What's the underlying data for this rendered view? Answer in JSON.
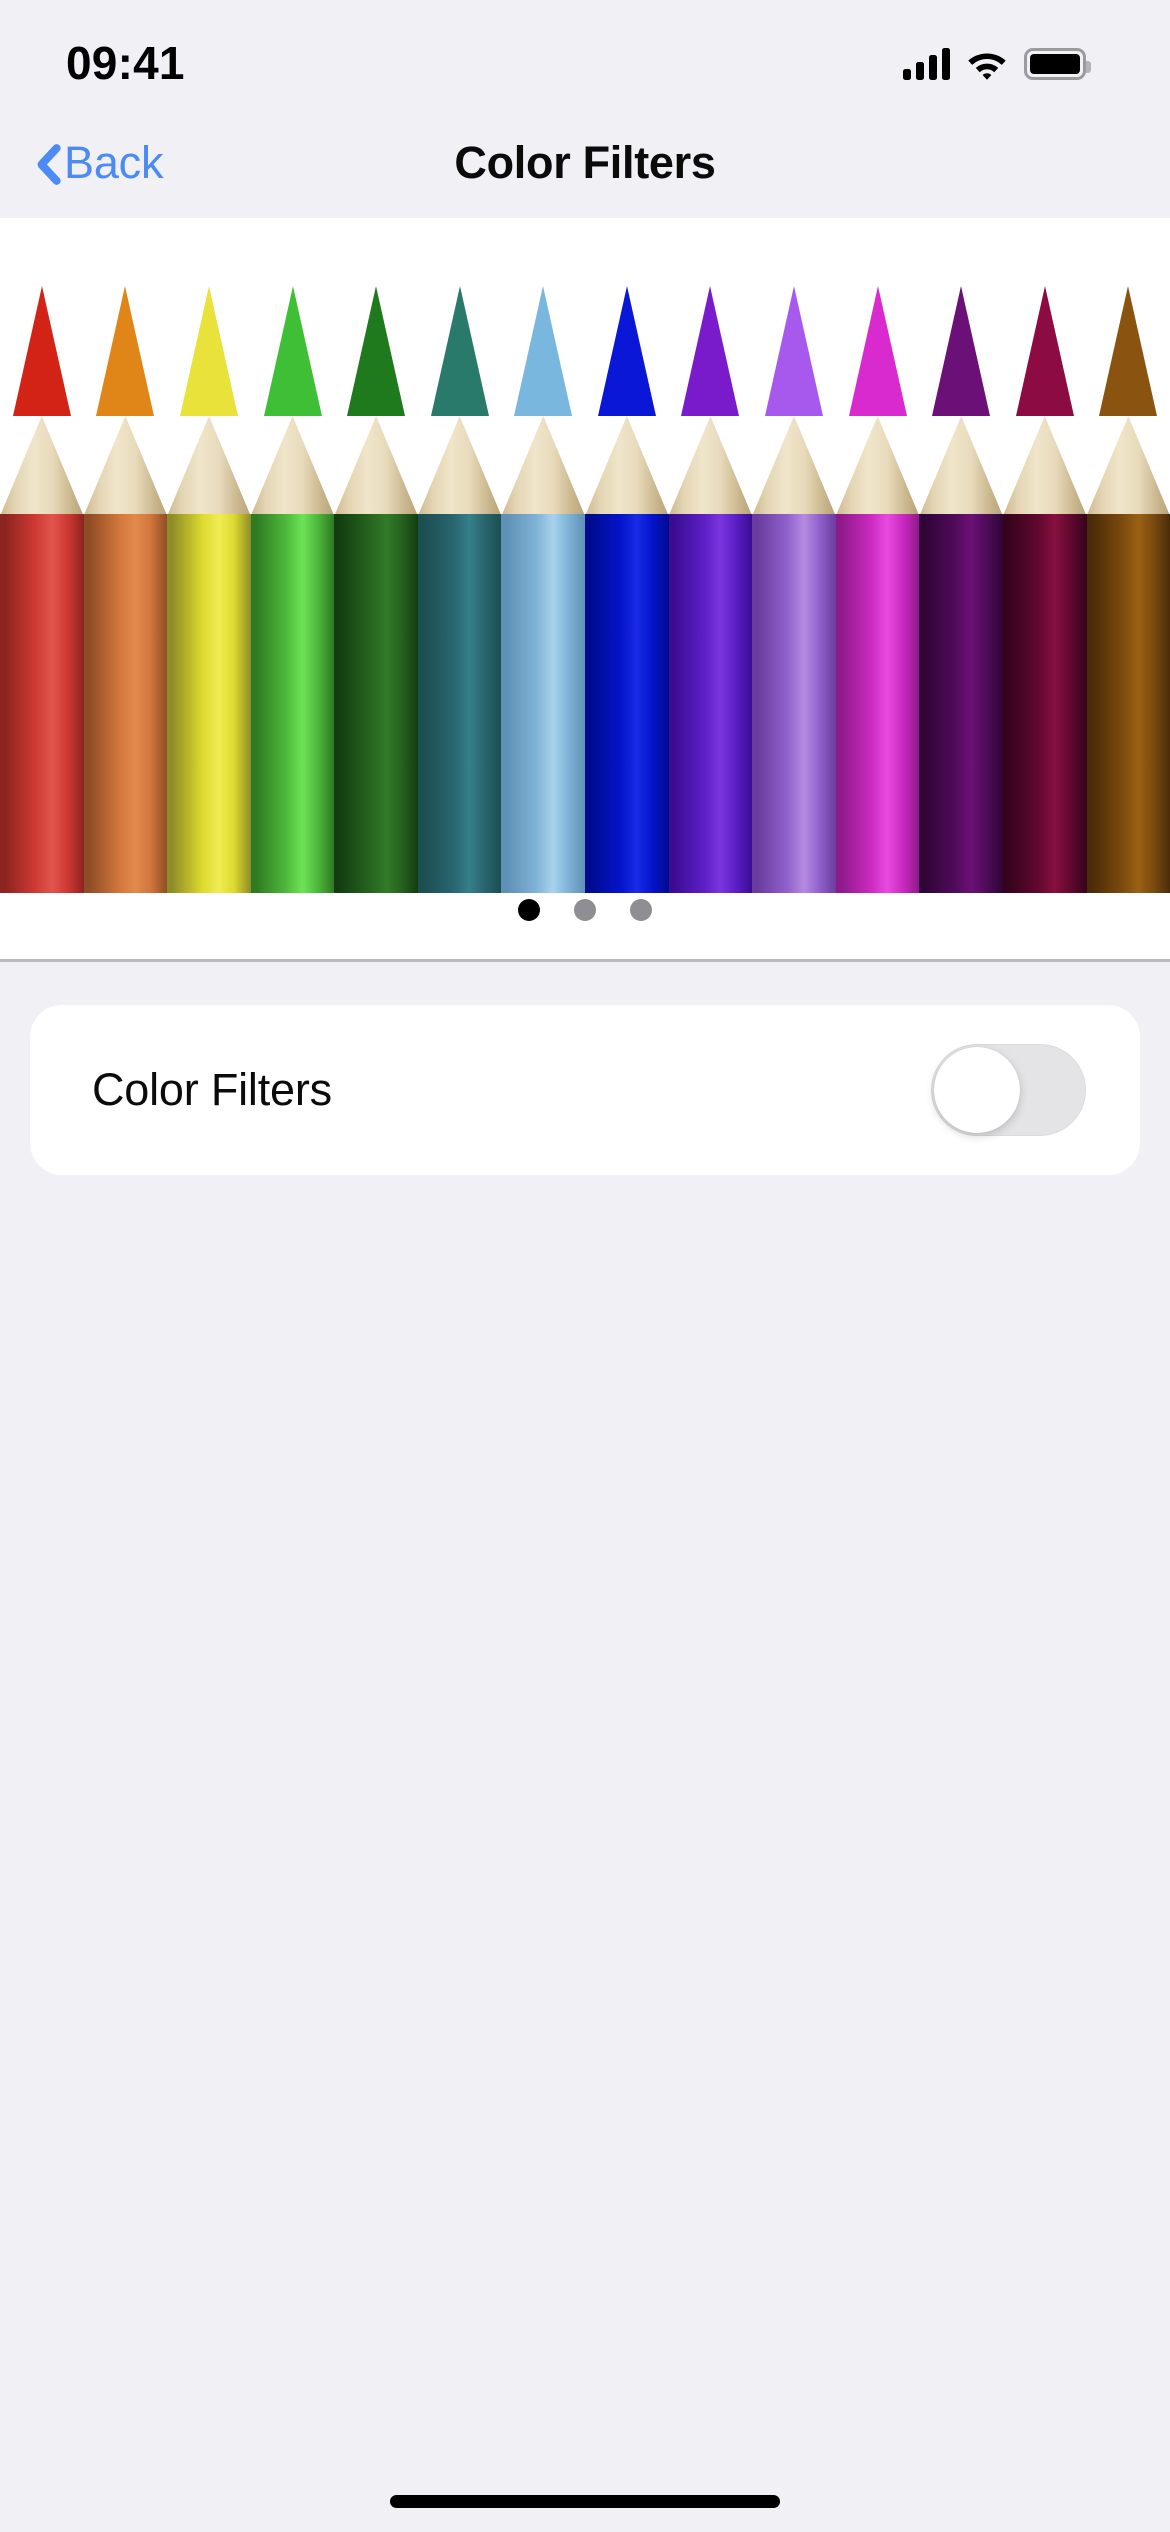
{
  "status_bar": {
    "time": "09:41",
    "cellular_icon": "signal-bars-icon",
    "wifi_icon": "wifi-icon",
    "battery_icon": "battery-full-icon"
  },
  "nav_bar": {
    "back_label": "Back",
    "back_icon": "chevron-left-icon",
    "title": "Color Filters"
  },
  "preview": {
    "image_name": "colored-pencils-photo",
    "pencils": [
      {
        "name": "red",
        "tip": "#D32316",
        "dark": "#8C2420",
        "main": "#CF3A33",
        "light": "#E0554C"
      },
      {
        "name": "orange",
        "tip": "#E08517",
        "dark": "#8F4D26",
        "main": "#D1763C",
        "light": "#E28A4E"
      },
      {
        "name": "yellow",
        "tip": "#E8E23B",
        "dark": "#8E8C27",
        "main": "#DCD92E",
        "light": "#F0ED55"
      },
      {
        "name": "light-green",
        "tip": "#3FBF35",
        "dark": "#2F7A22",
        "main": "#4FB83C",
        "light": "#6DE356"
      },
      {
        "name": "dark-green",
        "tip": "#1F7A1E",
        "dark": "#133D10",
        "main": "#26631F",
        "light": "#327B27"
      },
      {
        "name": "teal",
        "tip": "#2A7A6B",
        "dark": "#1C4F52",
        "main": "#29656E",
        "light": "#35808A"
      },
      {
        "name": "sky-blue",
        "tip": "#79B7DE",
        "dark": "#5F90B5",
        "main": "#7FB3D6",
        "light": "#A8D2EC"
      },
      {
        "name": "blue",
        "tip": "#0A17D6",
        "dark": "#000B8E",
        "main": "#0414C9",
        "light": "#1A2BE8"
      },
      {
        "name": "violet",
        "tip": "#7A1BCB",
        "dark": "#3B0C92",
        "main": "#5C1FC6",
        "light": "#7B35DE"
      },
      {
        "name": "light-purple",
        "tip": "#A659EC",
        "dark": "#6A3C9E",
        "main": "#9061CC",
        "light": "#B48BE0"
      },
      {
        "name": "magenta",
        "tip": "#D92ACF",
        "dark": "#8E1A8A",
        "main": "#CB2AC0",
        "light": "#E84BE0"
      },
      {
        "name": "dark-purple",
        "tip": "#6A1077",
        "dark": "#2E0535",
        "main": "#4F0B5A",
        "light": "#6B1177"
      },
      {
        "name": "dark-magenta",
        "tip": "#8C0B43",
        "dark": "#35041C",
        "main": "#61082F",
        "light": "#87103F"
      },
      {
        "name": "brown",
        "tip": "#8A5310",
        "dark": "#4B2C08",
        "main": "#7B4A0E",
        "light": "#9C6113"
      }
    ],
    "page_dots": {
      "total": 3,
      "active_index": 0
    }
  },
  "settings": {
    "rows": [
      {
        "label": "Color Filters",
        "toggle_state": "off"
      }
    ]
  },
  "home_indicator": "home-indicator-bar",
  "colors": {
    "background": "#F1F1F5",
    "card": "#FFFFFF",
    "accent_blue": "#4C8BF5",
    "switch_off_track": "#E4E4E6",
    "dot_inactive": "#8E8E93",
    "dot_active": "#000000",
    "separator": "#B9B9BE"
  }
}
